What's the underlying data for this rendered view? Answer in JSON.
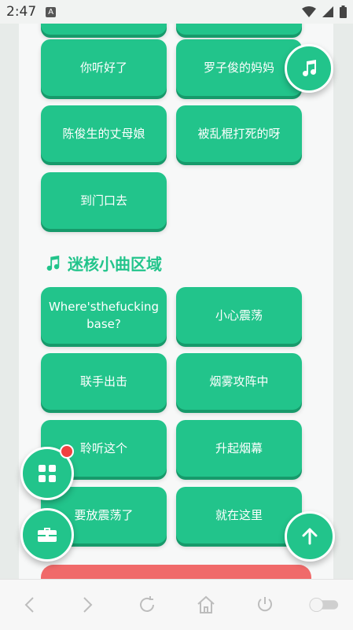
{
  "status_bar": {
    "time": "2:47",
    "notification_icon": "A"
  },
  "top_buttons": [
    {
      "label": "你听好了"
    },
    {
      "label": "罗子俊的妈妈"
    },
    {
      "label": "陈俊生的丈母娘"
    },
    {
      "label": "被乱棍打死的呀"
    },
    {
      "label": "到门口去"
    }
  ],
  "section": {
    "title": "迷核小曲区域",
    "icon": "music-note-icon",
    "buttons": [
      {
        "label": "Where'sthefucking base?"
      },
      {
        "label": "小心震荡"
      },
      {
        "label": "联手出击"
      },
      {
        "label": "烟雾攻阵中"
      },
      {
        "label": "聆听这个"
      },
      {
        "label": "升起烟幕"
      },
      {
        "label": "要放震荡了"
      },
      {
        "label": "就在这里"
      }
    ]
  },
  "fabs": {
    "music": "music-note-icon",
    "grid": "grid-icon",
    "toolbox": "toolbox-icon",
    "scroll_top": "arrow-up-icon"
  },
  "colors": {
    "accent": "#22c48b",
    "accent_shadow": "#179a6b",
    "danger": "#f06a6a",
    "badge": "#f04040"
  },
  "nav_bar": [
    "back-icon",
    "forward-icon",
    "refresh-icon",
    "home-icon",
    "power-icon",
    "toggle-switch"
  ]
}
